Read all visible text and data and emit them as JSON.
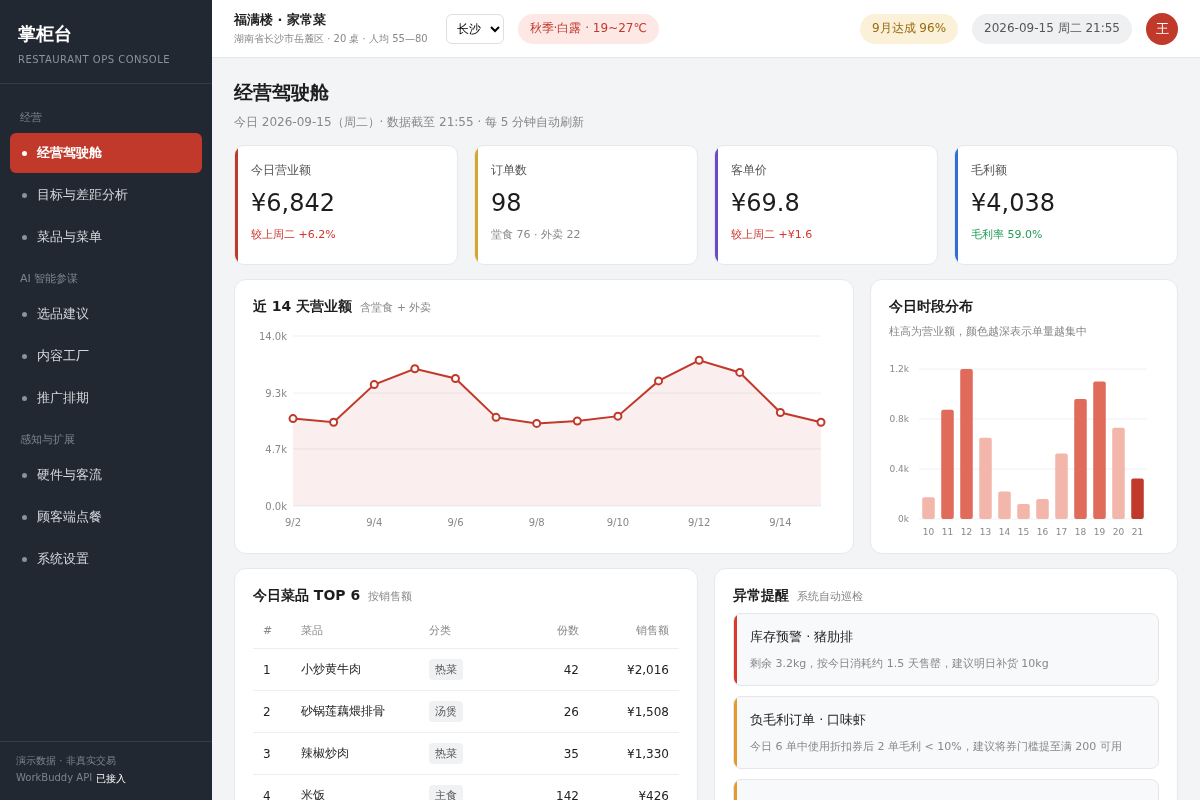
{
  "sidebar": {
    "brand": "掌柜台",
    "tagline": "RESTAURANT OPS CONSOLE",
    "sections": [
      {
        "title": "经营",
        "items": [
          {
            "label": "经营驾驶舱",
            "selected": true
          },
          {
            "label": "目标与差距分析",
            "selected": false
          },
          {
            "label": "菜品与菜单",
            "selected": false
          }
        ]
      },
      {
        "title": "AI 智能参谋",
        "items": [
          {
            "label": "选品建议",
            "selected": false
          },
          {
            "label": "内容工厂",
            "selected": false
          },
          {
            "label": "推广排期",
            "selected": false
          }
        ]
      },
      {
        "title": "感知与扩展",
        "items": [
          {
            "label": "硬件与客流",
            "selected": false
          },
          {
            "label": "顾客端点餐",
            "selected": false
          },
          {
            "label": "系统设置",
            "selected": false
          }
        ]
      }
    ],
    "footer": {
      "note": "演示数据 · 非真实交易",
      "api": "WorkBuddy API",
      "api_status": "已接入"
    }
  },
  "topbar": {
    "store": "福满楼 · 家常菜",
    "store_info": "湖南省长沙市岳麓区 · 20 桌 · 人均 55—80",
    "city": "长沙",
    "season": "秋季·白露 · 19~27℃",
    "goal": "9月达成 96%",
    "datetime": "2026-09-15 周二 21:55",
    "avatar": "王"
  },
  "page": {
    "title": "经营驾驶舱",
    "subtitle": "今日 2026-09-15（周二）· 数据截至 21:55 · 每 5 分钟自动刷新"
  },
  "kpis": [
    {
      "label": "今日营业额",
      "value": "¥6,842",
      "note": {
        "text": "较上周二 +6.2%",
        "color": "#d0342c"
      },
      "color": "#c0392b"
    },
    {
      "label": "订单数",
      "value": "98",
      "note": {
        "text": "堂食 76 · 外卖 22",
        "color": "#888888"
      },
      "color": "#d4a72c"
    },
    {
      "label": "客单价",
      "value": "¥69.8",
      "note": {
        "text": "较上周二 +¥1.6",
        "color": "#d0342c"
      },
      "color": "#6a4bc4"
    },
    {
      "label": "毛利额",
      "value": "¥4,038",
      "note": {
        "text": "毛利率 59.0%",
        "color": "#1f9d55"
      },
      "color": "#2f6fd6"
    }
  ],
  "trend": {
    "title": "近 14 天营业额",
    "hint": "含堂食 + 外卖",
    "chart_data": {
      "type": "area",
      "categories": [
        "9/2",
        null,
        "9/4",
        null,
        "9/6",
        null,
        "9/8",
        null,
        "9/10",
        null,
        "9/12",
        null,
        "9/14",
        null
      ],
      "series": [
        {
          "color": "#c0392b",
          "values": [
            7200,
            6900,
            10000,
            11300,
            10500,
            7300,
            6800,
            7000,
            7400,
            10300,
            12000,
            11000,
            7700,
            6900
          ]
        }
      ],
      "ylim": [
        0,
        14000
      ],
      "yticks": [
        {
          "value": 0,
          "label": "0.0k"
        },
        {
          "value": 4700,
          "label": "4.7k"
        },
        {
          "value": 9300,
          "label": "9.3k"
        },
        {
          "value": 14000,
          "label": "14.0k"
        }
      ]
    }
  },
  "hourly": {
    "title": "今日时段分布",
    "hint": "柱高为营业额，颜色越深表示单量越集中",
    "chart_data": {
      "type": "bar",
      "categories": [
        "10",
        "11",
        "12",
        "13",
        "14",
        "15",
        "16",
        "17",
        "18",
        "19",
        "20",
        "21"
      ],
      "stacked": true,
      "series": [
        {
          "color": "#f2b6aa",
          "values": [
            175,
            null,
            null,
            650,
            220,
            120,
            160,
            525,
            null,
            null,
            730,
            null
          ]
        },
        {
          "color": "#e06b5b",
          "values": [
            null,
            875,
            1200,
            null,
            null,
            null,
            null,
            null,
            960,
            1100,
            null,
            null
          ]
        },
        {
          "color": "#c0392b",
          "values": [
            null,
            null,
            null,
            null,
            null,
            null,
            null,
            null,
            null,
            null,
            null,
            325
          ]
        }
      ],
      "ylim": [
        0,
        1200
      ],
      "yticks": [
        {
          "value": 0,
          "label": "0k"
        },
        {
          "value": 400,
          "label": "0.4k"
        },
        {
          "value": 800,
          "label": "0.8k"
        },
        {
          "value": 1200,
          "label": "1.2k"
        }
      ]
    }
  },
  "dishes": {
    "title": "今日菜品 TOP 6",
    "hint": "按销售额",
    "columns": [
      "#",
      "菜品",
      "分类",
      "份数",
      "销售额"
    ],
    "rows": [
      [
        "1",
        "小炒黄牛肉",
        "热菜",
        "42",
        "¥2,016"
      ],
      [
        "2",
        "砂锅莲藕煨排骨",
        "汤煲",
        "26",
        "¥1,508"
      ],
      [
        "3",
        "辣椒炒肉",
        "热菜",
        "35",
        "¥1,330"
      ],
      [
        "4",
        "米饭",
        "主食",
        "142",
        "¥426"
      ]
    ]
  },
  "alerts": {
    "title": "异常提醒",
    "hint": "系统自动巡检",
    "items": [
      {
        "title": "库存预警 · 猪肋排",
        "detail": "剩余 3.2kg，按今日消耗约 1.5 天售罄，建议明日补货 10kg",
        "color": "#d93a2b"
      },
      {
        "title": "负毛利订单 · 口味虾",
        "detail": "今日 6 单中使用折扣券后 2 单毛利 < 10%，建议将券门槛提至满 200 可用",
        "color": "#e69a2e"
      },
      {
        "color": "#e69a2e"
      }
    ]
  }
}
